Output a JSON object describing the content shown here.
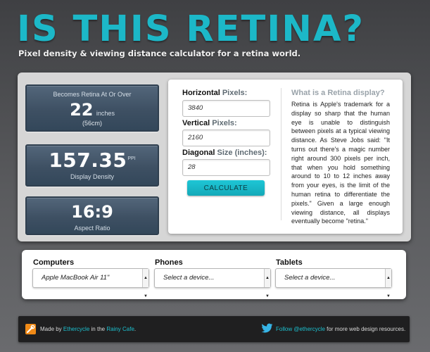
{
  "header": {
    "title": "IS THIS RETINA?",
    "subtitle": "Pixel density & viewing distance calculator for a retina world."
  },
  "stats": {
    "retina": {
      "label": "Becomes Retina At Or Over",
      "value": "22",
      "unit": "inches",
      "sub": "(56cm)"
    },
    "density": {
      "value": "157.35",
      "unit": "PPI",
      "label": "Display Density"
    },
    "aspect": {
      "value": "16:9",
      "label": "Aspect Ratio"
    }
  },
  "form": {
    "horizontal": {
      "label_bold": "Horizontal",
      "label_light": "Pixels:",
      "value": "3840"
    },
    "vertical": {
      "label_bold": "Vertical",
      "label_light": "Pixels:",
      "value": "2160"
    },
    "diagonal": {
      "label_bold": "Diagonal",
      "label_light": "Size (inches):",
      "value": "28"
    },
    "button": "CALCULATE"
  },
  "info": {
    "title": "What is a Retina display?",
    "text": "Retina is Apple's trademark for a display so sharp that the human eye is unable to distinguish between pixels at a typical viewing distance. As Steve Jobs said: \"It turns out there's a magic number right around 300 pixels per inch, that when you hold something around to 10 to 12 inches away from your eyes, is the limit of the human retina to differentiate the pixels.\" Given a large enough viewing distance, all displays eventually become \"retina.\""
  },
  "devices": {
    "computers": {
      "label": "Computers",
      "selected": "Apple MacBook Air 11\""
    },
    "phones": {
      "label": "Phones",
      "selected": "Select a device..."
    },
    "tablets": {
      "label": "Tablets",
      "selected": "Select a device..."
    }
  },
  "footer": {
    "made_by": "Made by",
    "ethercycle": "Ethercycle",
    "in_the": "in the",
    "rainy_cafe": "Rainy Cafe",
    "period": ".",
    "follow": "Follow @ethercycle",
    "follow_rest": "for more web design resources."
  },
  "colors": {
    "accent": "#1cb8c8",
    "stat_bg": "#3e5063",
    "logo_orange": "#f08a17"
  }
}
